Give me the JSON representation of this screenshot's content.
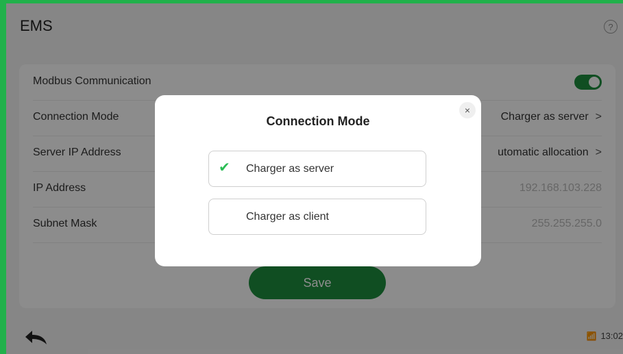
{
  "header": {
    "title": "EMS",
    "help_icon": "help-circle-icon"
  },
  "settings": {
    "rows": [
      {
        "label": "Modbus Communication",
        "value": "",
        "control": "toggle",
        "toggle_on": true
      },
      {
        "label": "Connection Mode",
        "value": "Charger as server",
        "control": "chevron"
      },
      {
        "label": "Server IP Address",
        "value": "utomatic allocation",
        "control": "chevron"
      },
      {
        "label": "IP Address",
        "value": "192.168.103.228",
        "control": "none"
      },
      {
        "label": "Subnet Mask",
        "value": "255.255.255.0",
        "control": "none"
      }
    ],
    "save_label": "Save",
    "chevron": ">"
  },
  "bottombar": {
    "time": "13:02",
    "signal_icon": "signal-alert-icon",
    "back_icon": "back-arrow-icon"
  },
  "modal": {
    "title": "Connection Mode",
    "close": "×",
    "options": [
      {
        "label": "Charger as server",
        "selected": true
      },
      {
        "label": "Charger as client",
        "selected": false
      }
    ],
    "check": "✔"
  },
  "colors": {
    "accent": "#1e8e3e",
    "check": "#2bbd55",
    "border": "#21b14b"
  }
}
